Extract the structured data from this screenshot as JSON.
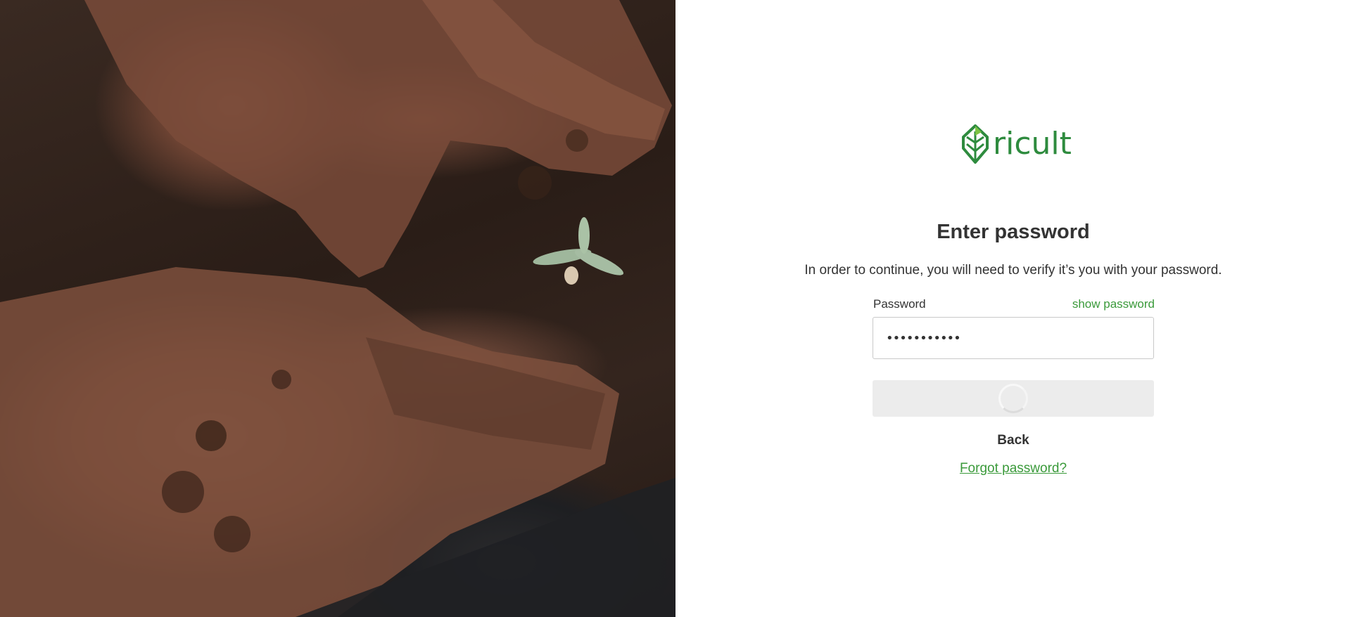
{
  "hero": {
    "image": "hands-in-soil-with-seedling-photo"
  },
  "brand": {
    "name": "ricult",
    "logo_icon": "leaf-logo-icon",
    "color": "#2e8b3e"
  },
  "login": {
    "title": "Enter password",
    "subtitle": "In order to continue, you will need to verify it’s you with your password.",
    "password_label": "Password",
    "show_password": "show password",
    "password_value": "•••••••••••",
    "submit_state": "loading",
    "back_label": "Back",
    "forgot_label": "Forgot password?"
  },
  "colors": {
    "accent": "#3a9a3a",
    "button_bg": "#ececec",
    "text": "#333333"
  }
}
